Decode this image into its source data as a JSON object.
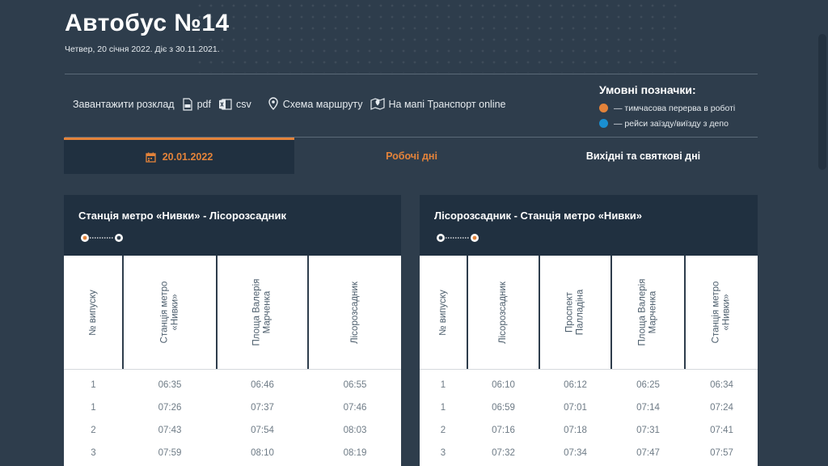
{
  "page": {
    "title": "Автобус №14",
    "subtitle": "Четвер, 20 січня 2022. Діє з 30.11.2021."
  },
  "toolbar": {
    "download_label": "Завантажити розклад",
    "pdf_label": "pdf",
    "csv_label": "csv",
    "route_scheme_label": "Схема маршруту",
    "map_label": "На мапі Транспорт online"
  },
  "legend": {
    "title": "Умовні позначки:",
    "items": [
      {
        "label": "— тимчасова перерва в роботі",
        "color": "#e4833a"
      },
      {
        "label": "— рейси заїзду/виїзду з депо",
        "color": "#1a8fd1"
      }
    ]
  },
  "tabs": {
    "date": "20.01.2022",
    "workdays": "Робочі дні",
    "weekends": "Вихідні та святкові дні"
  },
  "colors": {
    "background": "#2e3d4c",
    "panel": "#203040",
    "accent": "#e4833a",
    "depot": "#1a8fd1"
  },
  "directions": [
    {
      "title": "Станція метро «Нивки» - Лісорозсадник",
      "columns": [
        "№ випуску",
        "Станція метро\n«Нивки»",
        "Площа Валерія\nМарченка",
        "Лісорозсадник"
      ],
      "rows": [
        [
          "1",
          "06:35",
          "06:46",
          "06:55"
        ],
        [
          "1",
          "07:26",
          "07:37",
          "07:46"
        ],
        [
          "2",
          "07:43",
          "07:54",
          "08:03"
        ],
        [
          "3",
          "07:59",
          "08:10",
          "08:19"
        ]
      ]
    },
    {
      "title": "Лісорозсадник - Станція метро «Нивки»",
      "columns": [
        "№ випуску",
        "Лісорозсадник",
        "Проспект\nПалладіна",
        "Площа Валерія\nМарченка",
        "Станція метро\n«Нивки»"
      ],
      "rows": [
        [
          "1",
          "06:10",
          "06:12",
          "06:25",
          "06:34"
        ],
        [
          "1",
          "06:59",
          "07:01",
          "07:14",
          "07:24"
        ],
        [
          "2",
          "07:16",
          "07:18",
          "07:31",
          "07:41"
        ],
        [
          "3",
          "07:32",
          "07:34",
          "07:47",
          "07:57"
        ]
      ]
    }
  ]
}
